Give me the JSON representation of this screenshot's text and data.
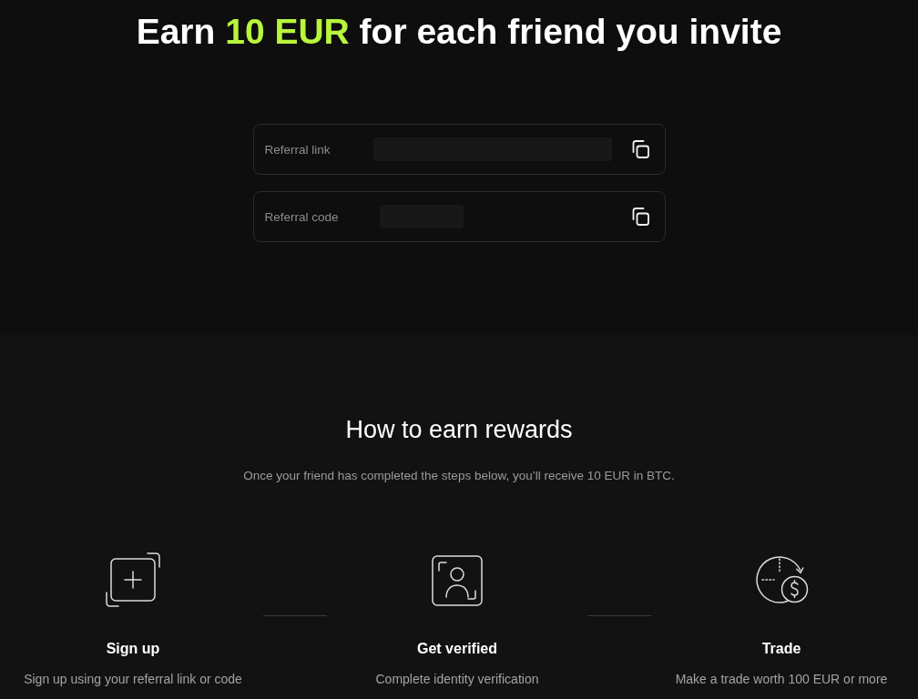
{
  "headline": [
    {
      "text": "Earn",
      "highlight": false
    },
    {
      "text": "10 EUR",
      "highlight": true
    },
    {
      "text": "for each friend you invite",
      "highlight": false
    }
  ],
  "referral_fields": [
    {
      "kind": "link",
      "label": "Referral link",
      "masked": true
    },
    {
      "kind": "code",
      "label": "Referral code",
      "masked": true
    }
  ],
  "how_to": {
    "title": "How to earn rewards",
    "subtitle": "Once your friend has completed the steps below, you’ll receive 10 EUR in BTC.",
    "steps": [
      {
        "kind": "signup",
        "title": "Sign up",
        "description": "Sign up using your referral link or code"
      },
      {
        "kind": "verify",
        "title": "Get verified",
        "description": "Complete identity verification"
      },
      {
        "kind": "trade",
        "title": "Trade",
        "description": "Make a trade worth 100 EUR or more"
      }
    ]
  }
}
